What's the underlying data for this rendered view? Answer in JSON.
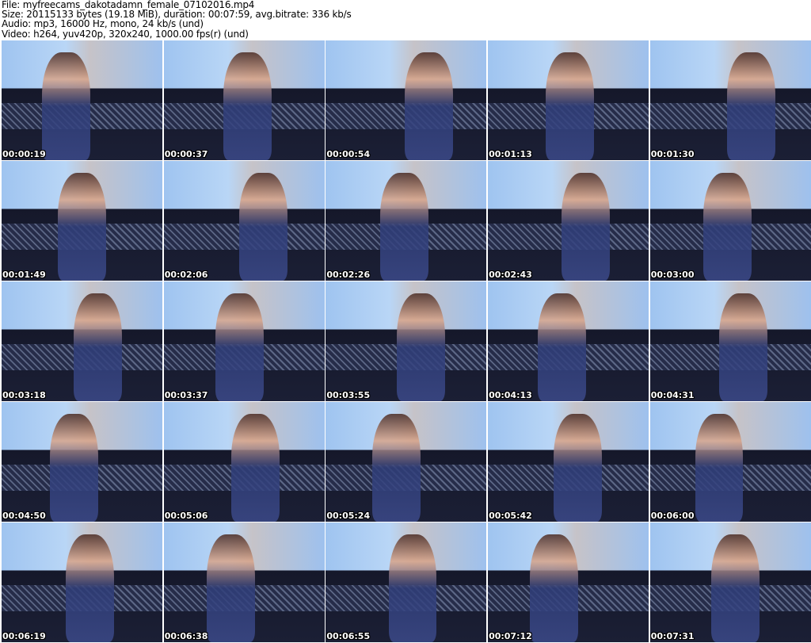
{
  "header": {
    "file": "File: myfreecams_dakotadamn_female_07102016.mp4",
    "size": "Size: 20115133 bytes (19.18 MiB), duration: 00:07:59, avg.bitrate: 336 kb/s",
    "audio": "Audio: mp3, 16000 Hz, mono, 24 kb/s (und)",
    "video": "Video: h264, yuv420p, 320x240, 1000.00 fps(r) (und)"
  },
  "thumbnails": [
    "00:00:19",
    "00:00:37",
    "00:00:54",
    "00:01:13",
    "00:01:30",
    "00:01:49",
    "00:02:06",
    "00:02:26",
    "00:02:43",
    "00:03:00",
    "00:03:18",
    "00:03:37",
    "00:03:55",
    "00:04:13",
    "00:04:31",
    "00:04:50",
    "00:05:06",
    "00:05:24",
    "00:05:42",
    "00:06:00",
    "00:06:19",
    "00:06:38",
    "00:06:55",
    "00:07:12",
    "00:07:31"
  ]
}
